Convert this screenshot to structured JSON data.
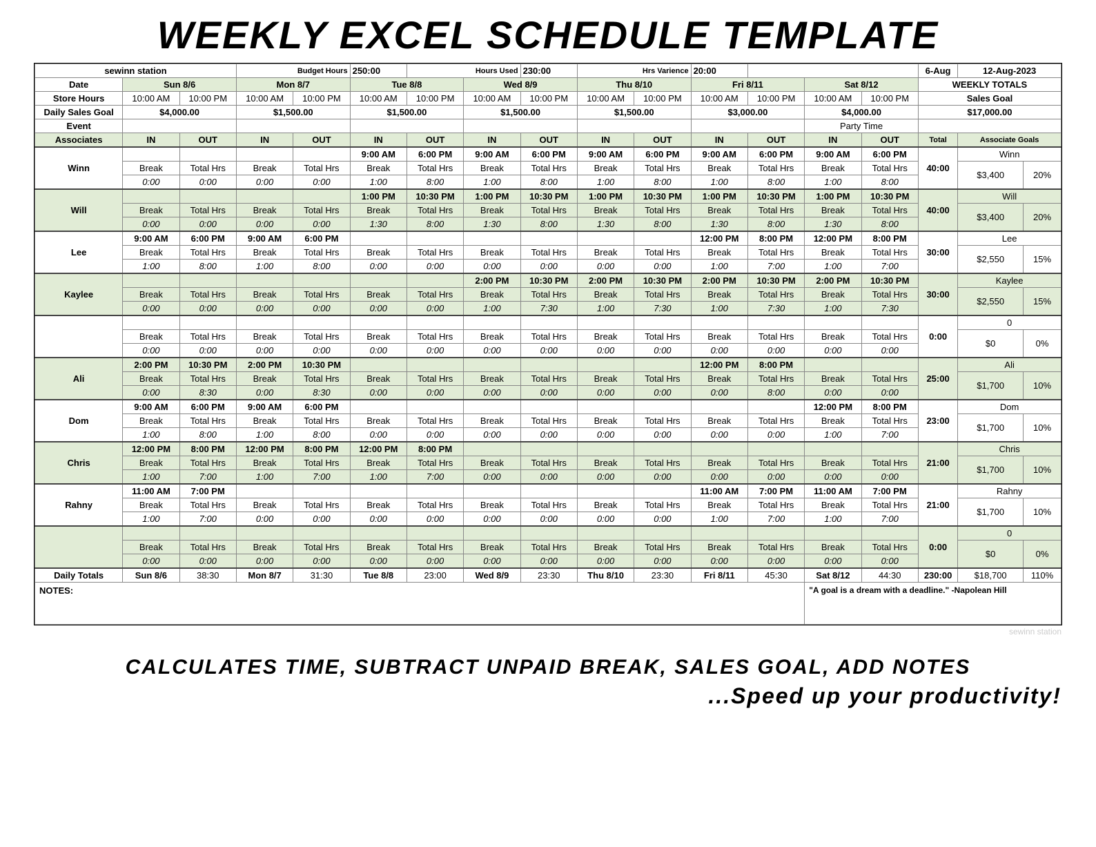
{
  "title": "Weekly Excel Schedule Template",
  "header": {
    "station": "sewinn station",
    "budget_hours_label": "Budget Hours",
    "budget_hours": "250:00",
    "hours_used_label": "Hours Used",
    "hours_used": "230:00",
    "hrs_variance_label": "Hrs Varience",
    "hrs_variance": "20:00",
    "date_short": "6-Aug",
    "week_date": "12-Aug-2023"
  },
  "labels": {
    "date": "Date",
    "store_hours": "Store Hours",
    "daily_sales_goal": "Daily Sales Goal",
    "event": "Event",
    "associates": "Associates",
    "in": "IN",
    "out": "OUT",
    "break": "Break",
    "total_hrs": "Total Hrs",
    "daily_totals": "Daily Totals",
    "notes": "NOTES:",
    "weekly_totals": "WEEKLY TOTALS",
    "sales_goal": "Sales Goal",
    "total": "Total",
    "associate_goals": "Associate Goals"
  },
  "days": [
    {
      "label": "Sun 8/6",
      "open": "10:00 AM",
      "close": "10:00 PM",
      "goal": "$4,000.00",
      "event": ""
    },
    {
      "label": "Mon 8/7",
      "open": "10:00 AM",
      "close": "10:00 PM",
      "goal": "$1,500.00",
      "event": ""
    },
    {
      "label": "Tue 8/8",
      "open": "10:00 AM",
      "close": "10:00 PM",
      "goal": "$1,500.00",
      "event": ""
    },
    {
      "label": "Wed 8/9",
      "open": "10:00 AM",
      "close": "10:00 PM",
      "goal": "$1,500.00",
      "event": ""
    },
    {
      "label": "Thu 8/10",
      "open": "10:00 AM",
      "close": "10:00 PM",
      "goal": "$1,500.00",
      "event": ""
    },
    {
      "label": "Fri 8/11",
      "open": "10:00 AM",
      "close": "10:00 PM",
      "goal": "$3,000.00",
      "event": ""
    },
    {
      "label": "Sat 8/12",
      "open": "10:00 AM",
      "close": "10:00 PM",
      "goal": "$4,000.00",
      "event": "Party Time"
    }
  ],
  "weekly": {
    "sales_goal_value": "$17,000.00",
    "grand_total_hours": "230:00",
    "grand_total_goal": "$18,700",
    "grand_total_pct": "110%"
  },
  "daily_totals": [
    "38:30",
    "31:30",
    "23:00",
    "23:30",
    "23:30",
    "45:30",
    "44:30"
  ],
  "associates": [
    {
      "name": "Winn",
      "bg": false,
      "total": "40:00",
      "goal_name": "Winn",
      "goal_amount": "$3,400",
      "goal_pct": "20%",
      "days": [
        {
          "in": "",
          "out": "",
          "break": "0:00",
          "hrs": "0:00"
        },
        {
          "in": "",
          "out": "",
          "break": "0:00",
          "hrs": "0:00"
        },
        {
          "in": "9:00 AM",
          "out": "6:00 PM",
          "break": "1:00",
          "hrs": "8:00"
        },
        {
          "in": "9:00 AM",
          "out": "6:00 PM",
          "break": "1:00",
          "hrs": "8:00"
        },
        {
          "in": "9:00 AM",
          "out": "6:00 PM",
          "break": "1:00",
          "hrs": "8:00"
        },
        {
          "in": "9:00 AM",
          "out": "6:00 PM",
          "break": "1:00",
          "hrs": "8:00"
        },
        {
          "in": "9:00 AM",
          "out": "6:00 PM",
          "break": "1:00",
          "hrs": "8:00"
        }
      ]
    },
    {
      "name": "Will",
      "bg": true,
      "total": "40:00",
      "goal_name": "Will",
      "goal_amount": "$3,400",
      "goal_pct": "20%",
      "days": [
        {
          "in": "",
          "out": "",
          "break": "0:00",
          "hrs": "0:00"
        },
        {
          "in": "",
          "out": "",
          "break": "0:00",
          "hrs": "0:00"
        },
        {
          "in": "1:00 PM",
          "out": "10:30 PM",
          "break": "1:30",
          "hrs": "8:00"
        },
        {
          "in": "1:00 PM",
          "out": "10:30 PM",
          "break": "1:30",
          "hrs": "8:00"
        },
        {
          "in": "1:00 PM",
          "out": "10:30 PM",
          "break": "1:30",
          "hrs": "8:00"
        },
        {
          "in": "1:00 PM",
          "out": "10:30 PM",
          "break": "1:30",
          "hrs": "8:00"
        },
        {
          "in": "1:00 PM",
          "out": "10:30 PM",
          "break": "1:30",
          "hrs": "8:00"
        }
      ]
    },
    {
      "name": "Lee",
      "bg": false,
      "total": "30:00",
      "goal_name": "Lee",
      "goal_amount": "$2,550",
      "goal_pct": "15%",
      "days": [
        {
          "in": "9:00 AM",
          "out": "6:00 PM",
          "break": "1:00",
          "hrs": "8:00"
        },
        {
          "in": "9:00 AM",
          "out": "6:00 PM",
          "break": "1:00",
          "hrs": "8:00"
        },
        {
          "in": "",
          "out": "",
          "break": "0:00",
          "hrs": "0:00"
        },
        {
          "in": "",
          "out": "",
          "break": "0:00",
          "hrs": "0:00"
        },
        {
          "in": "",
          "out": "",
          "break": "0:00",
          "hrs": "0:00"
        },
        {
          "in": "12:00 PM",
          "out": "8:00 PM",
          "break": "1:00",
          "hrs": "7:00"
        },
        {
          "in": "12:00 PM",
          "out": "8:00 PM",
          "break": "1:00",
          "hrs": "7:00"
        }
      ]
    },
    {
      "name": "Kaylee",
      "bg": true,
      "total": "30:00",
      "goal_name": "Kaylee",
      "goal_amount": "$2,550",
      "goal_pct": "15%",
      "days": [
        {
          "in": "",
          "out": "",
          "break": "0:00",
          "hrs": "0:00"
        },
        {
          "in": "",
          "out": "",
          "break": "0:00",
          "hrs": "0:00"
        },
        {
          "in": "",
          "out": "",
          "break": "0:00",
          "hrs": "0:00"
        },
        {
          "in": "2:00 PM",
          "out": "10:30 PM",
          "break": "1:00",
          "hrs": "7:30"
        },
        {
          "in": "2:00 PM",
          "out": "10:30 PM",
          "break": "1:00",
          "hrs": "7:30"
        },
        {
          "in": "2:00 PM",
          "out": "10:30 PM",
          "break": "1:00",
          "hrs": "7:30"
        },
        {
          "in": "2:00 PM",
          "out": "10:30 PM",
          "break": "1:00",
          "hrs": "7:30"
        }
      ]
    },
    {
      "name": "",
      "bg": false,
      "total": "0:00",
      "goal_name": "0",
      "goal_amount": "$0",
      "goal_pct": "0%",
      "days": [
        {
          "in": "",
          "out": "",
          "break": "0:00",
          "hrs": "0:00"
        },
        {
          "in": "",
          "out": "",
          "break": "0:00",
          "hrs": "0:00"
        },
        {
          "in": "",
          "out": "",
          "break": "0:00",
          "hrs": "0:00"
        },
        {
          "in": "",
          "out": "",
          "break": "0:00",
          "hrs": "0:00"
        },
        {
          "in": "",
          "out": "",
          "break": "0:00",
          "hrs": "0:00"
        },
        {
          "in": "",
          "out": "",
          "break": "0:00",
          "hrs": "0:00"
        },
        {
          "in": "",
          "out": "",
          "break": "0:00",
          "hrs": "0:00"
        }
      ]
    },
    {
      "name": "Ali",
      "bg": true,
      "total": "25:00",
      "goal_name": "Ali",
      "goal_amount": "$1,700",
      "goal_pct": "10%",
      "days": [
        {
          "in": "2:00 PM",
          "out": "10:30 PM",
          "break": "0:00",
          "hrs": "8:30"
        },
        {
          "in": "2:00 PM",
          "out": "10:30 PM",
          "break": "0:00",
          "hrs": "8:30"
        },
        {
          "in": "",
          "out": "",
          "break": "0:00",
          "hrs": "0:00"
        },
        {
          "in": "",
          "out": "",
          "break": "0:00",
          "hrs": "0:00"
        },
        {
          "in": "",
          "out": "",
          "break": "0:00",
          "hrs": "0:00"
        },
        {
          "in": "12:00 PM",
          "out": "8:00 PM",
          "break": "0:00",
          "hrs": "8:00"
        },
        {
          "in": "",
          "out": "",
          "break": "0:00",
          "hrs": "0:00"
        }
      ]
    },
    {
      "name": "Dom",
      "bg": false,
      "total": "23:00",
      "goal_name": "Dom",
      "goal_amount": "$1,700",
      "goal_pct": "10%",
      "days": [
        {
          "in": "9:00 AM",
          "out": "6:00 PM",
          "break": "1:00",
          "hrs": "8:00"
        },
        {
          "in": "9:00 AM",
          "out": "6:00 PM",
          "break": "1:00",
          "hrs": "8:00"
        },
        {
          "in": "",
          "out": "",
          "break": "0:00",
          "hrs": "0:00"
        },
        {
          "in": "",
          "out": "",
          "break": "0:00",
          "hrs": "0:00"
        },
        {
          "in": "",
          "out": "",
          "break": "0:00",
          "hrs": "0:00"
        },
        {
          "in": "",
          "out": "",
          "break": "0:00",
          "hrs": "0:00"
        },
        {
          "in": "12:00 PM",
          "out": "8:00 PM",
          "break": "1:00",
          "hrs": "7:00"
        }
      ]
    },
    {
      "name": "Chris",
      "bg": true,
      "total": "21:00",
      "goal_name": "Chris",
      "goal_amount": "$1,700",
      "goal_pct": "10%",
      "days": [
        {
          "in": "12:00 PM",
          "out": "8:00 PM",
          "break": "1:00",
          "hrs": "7:00"
        },
        {
          "in": "12:00 PM",
          "out": "8:00 PM",
          "break": "1:00",
          "hrs": "7:00"
        },
        {
          "in": "12:00 PM",
          "out": "8:00 PM",
          "break": "1:00",
          "hrs": "7:00"
        },
        {
          "in": "",
          "out": "",
          "break": "0:00",
          "hrs": "0:00"
        },
        {
          "in": "",
          "out": "",
          "break": "0:00",
          "hrs": "0:00"
        },
        {
          "in": "",
          "out": "",
          "break": "0:00",
          "hrs": "0:00"
        },
        {
          "in": "",
          "out": "",
          "break": "0:00",
          "hrs": "0:00"
        }
      ]
    },
    {
      "name": "Rahny",
      "bg": false,
      "total": "21:00",
      "goal_name": "Rahny",
      "goal_amount": "$1,700",
      "goal_pct": "10%",
      "days": [
        {
          "in": "11:00 AM",
          "out": "7:00 PM",
          "break": "1:00",
          "hrs": "7:00"
        },
        {
          "in": "",
          "out": "",
          "break": "0:00",
          "hrs": "0:00"
        },
        {
          "in": "",
          "out": "",
          "break": "0:00",
          "hrs": "0:00"
        },
        {
          "in": "",
          "out": "",
          "break": "0:00",
          "hrs": "0:00"
        },
        {
          "in": "",
          "out": "",
          "break": "0:00",
          "hrs": "0:00"
        },
        {
          "in": "11:00 AM",
          "out": "7:00 PM",
          "break": "1:00",
          "hrs": "7:00"
        },
        {
          "in": "11:00 AM",
          "out": "7:00 PM",
          "break": "1:00",
          "hrs": "7:00"
        }
      ]
    },
    {
      "name": "",
      "bg": true,
      "total": "0:00",
      "goal_name": "0",
      "goal_amount": "$0",
      "goal_pct": "0%",
      "days": [
        {
          "in": "",
          "out": "",
          "break": "0:00",
          "hrs": "0:00"
        },
        {
          "in": "",
          "out": "",
          "break": "0:00",
          "hrs": "0:00"
        },
        {
          "in": "",
          "out": "",
          "break": "0:00",
          "hrs": "0:00"
        },
        {
          "in": "",
          "out": "",
          "break": "0:00",
          "hrs": "0:00"
        },
        {
          "in": "",
          "out": "",
          "break": "0:00",
          "hrs": "0:00"
        },
        {
          "in": "",
          "out": "",
          "break": "0:00",
          "hrs": "0:00"
        },
        {
          "in": "",
          "out": "",
          "break": "0:00",
          "hrs": "0:00"
        }
      ]
    }
  ],
  "quote": "\"A goal is a dream with a deadline.\" -Napolean Hill",
  "footer_line1": "calculates time, subtract unpaid break, sales goal, add notes",
  "footer_line2": "...Speed up your productivity!",
  "watermark": "sewinn station"
}
